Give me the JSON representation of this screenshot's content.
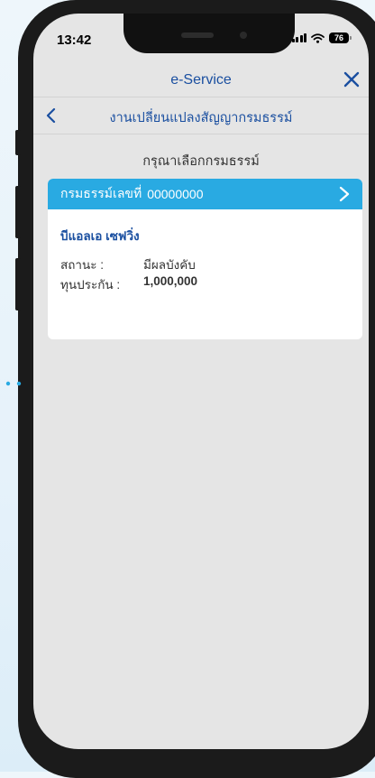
{
  "status_bar": {
    "time": "13:42",
    "battery": "76"
  },
  "header": {
    "title": "e-Service"
  },
  "subnav": {
    "title": "งานเปลี่ยนแปลงสัญญากรมธรรม์"
  },
  "main": {
    "prompt": "กรุณาเลือกกรมธรรม์",
    "policy_card": {
      "header_label": "กรมธรรม์เลขที่",
      "policy_number": "00000000",
      "plan_name": "บีแอลเอ เซฟวิ่ง",
      "status_label": "สถานะ :",
      "status_value": "มีผลบังคับ",
      "sum_label": "ทุนประกัน :",
      "sum_value": "1,000,000"
    }
  },
  "colors": {
    "accent": "#1a4fa0",
    "card_header": "#29aae2",
    "background": "#e5e5e5"
  }
}
